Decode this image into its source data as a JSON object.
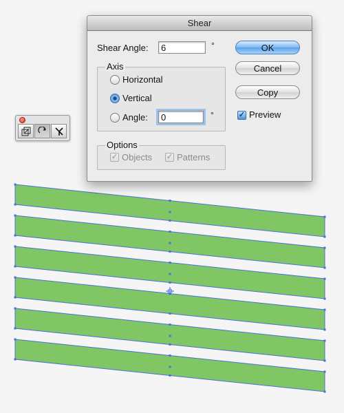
{
  "dialog": {
    "title": "Shear",
    "shear_angle_label": "Shear Angle:",
    "shear_angle_value": "6",
    "degree_symbol": "°",
    "axis_group_label": "Axis",
    "axis_options": [
      "Horizontal",
      "Vertical",
      "Angle:"
    ],
    "axis_selected": "Vertical",
    "axis_angle_value": "0",
    "options_group_label": "Options",
    "objects_label": "Objects",
    "patterns_label": "Patterns",
    "ok_label": "OK",
    "cancel_label": "Cancel",
    "copy_label": "Copy",
    "preview_label": "Preview",
    "preview_checked": true,
    "objects_checked": true,
    "patterns_checked": true
  },
  "mini_panel": {
    "tools": [
      "scale-tool-icon",
      "rotate-tool-icon",
      "shear-tool-icon"
    ],
    "selected_tool": "rotate-tool-icon"
  },
  "artwork": {
    "fill_color": "#80c665",
    "outline_color": "#4a6fd8",
    "stripe_count": 6
  }
}
